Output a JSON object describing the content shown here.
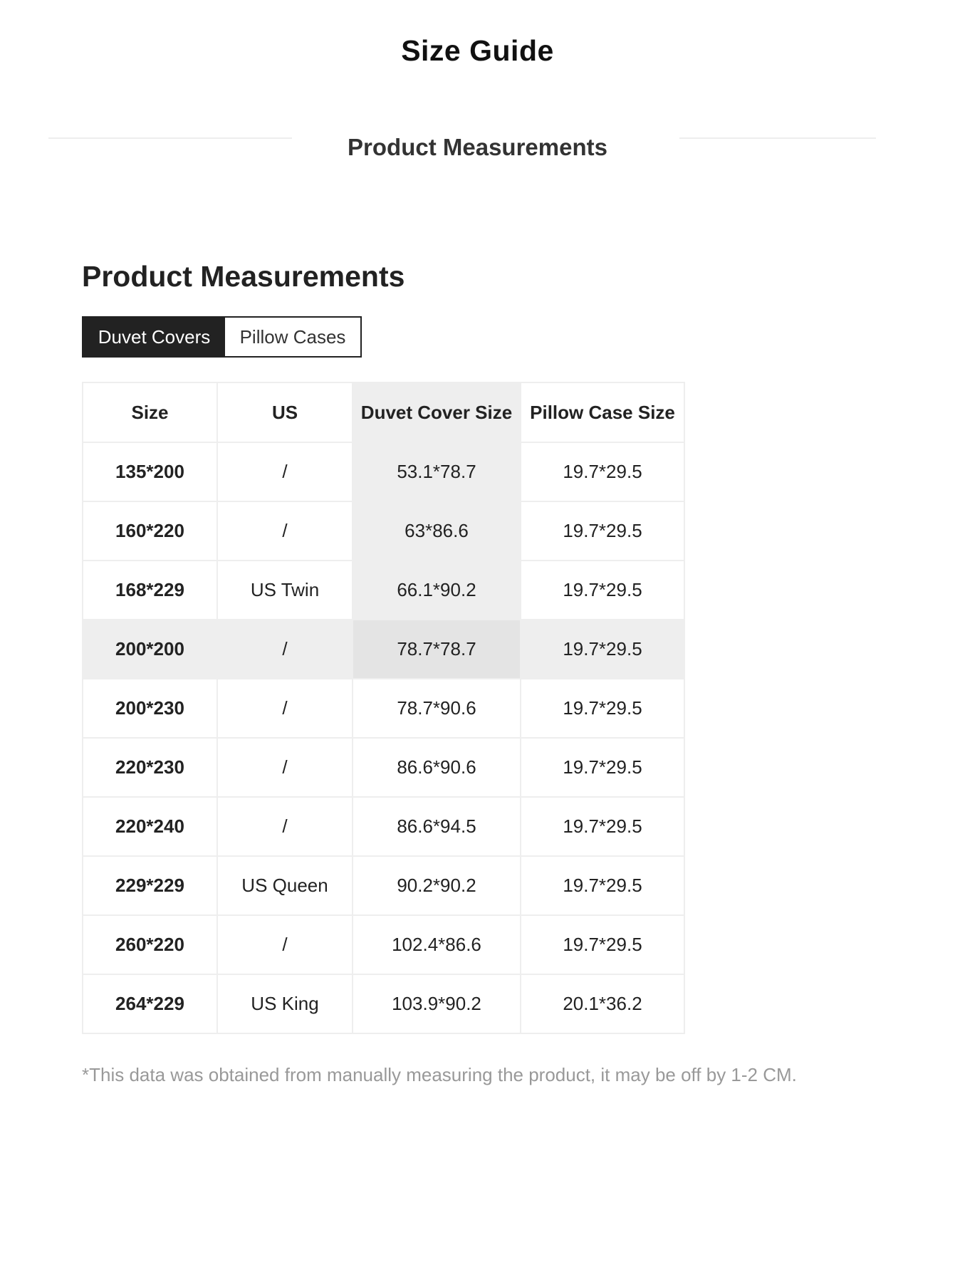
{
  "header": {
    "title": "Size Guide",
    "subtitle": "Product Measurements"
  },
  "section": {
    "heading": "Product Measurements",
    "tabs": [
      {
        "label": "Duvet Covers",
        "active": true
      },
      {
        "label": "Pillow Cases",
        "active": false
      }
    ]
  },
  "table": {
    "columns": [
      "Size",
      "US",
      "Duvet Cover Size",
      "Pillow Case Size"
    ],
    "rows": [
      [
        "135*200",
        "/",
        "53.1*78.7",
        "19.7*29.5"
      ],
      [
        "160*220",
        "/",
        "63*86.6",
        "19.7*29.5"
      ],
      [
        "168*229",
        "US Twin",
        "66.1*90.2",
        "19.7*29.5"
      ],
      [
        "200*200",
        "/",
        "78.7*78.7",
        "19.7*29.5"
      ],
      [
        "200*230",
        "/",
        "78.7*90.6",
        "19.7*29.5"
      ],
      [
        "220*230",
        "/",
        "86.6*90.6",
        "19.7*29.5"
      ],
      [
        "220*240",
        "/",
        "86.6*94.5",
        "19.7*29.5"
      ],
      [
        "229*229",
        "US Queen",
        "90.2*90.2",
        "19.7*29.5"
      ],
      [
        "260*220",
        "/",
        "102.4*86.6",
        "19.7*29.5"
      ],
      [
        "264*229",
        "US King",
        "103.9*90.2",
        "20.1*36.2"
      ]
    ],
    "highlighted_row": 3,
    "highlighted_column": 2
  },
  "footnote": "*This data was obtained from manually measuring the product, it may be off by 1-2 CM.",
  "colors": {
    "active_tab_bg": "#222222",
    "highlight": "#eeeeee",
    "border": "#eeeeee",
    "footnote_text": "#999999"
  }
}
